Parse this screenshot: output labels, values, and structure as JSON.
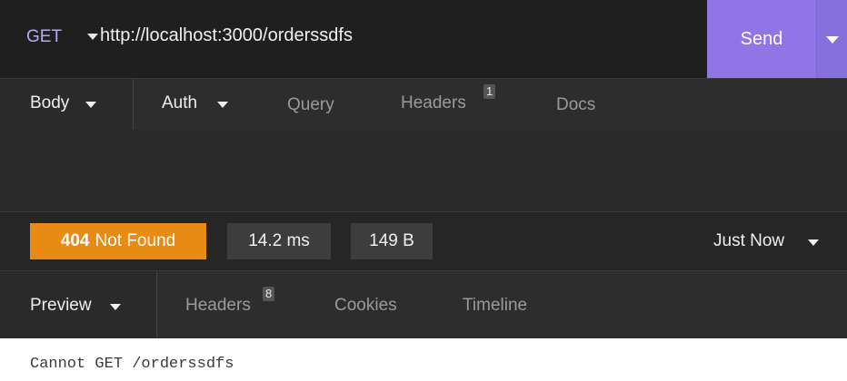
{
  "request": {
    "method": "GET",
    "url": "http://localhost:3000/orderssdfs",
    "send_label": "Send",
    "tabs": {
      "body": "Body",
      "auth": "Auth",
      "query": "Query",
      "headers": "Headers",
      "headers_count": "1",
      "docs": "Docs"
    }
  },
  "response": {
    "status_code": "404",
    "status_text": "Not Found",
    "time": "14.2 ms",
    "size": "149 B",
    "when": "Just Now",
    "tabs": {
      "preview": "Preview",
      "headers": "Headers",
      "headers_count": "8",
      "cookies": "Cookies",
      "timeline": "Timeline"
    },
    "body_text": "Cannot GET /orderssdfs"
  },
  "colors": {
    "accent": "#8f75e6",
    "status": "#e88b13",
    "method": "#b7a7ff"
  },
  "icons": [
    "caret-down-icon"
  ]
}
